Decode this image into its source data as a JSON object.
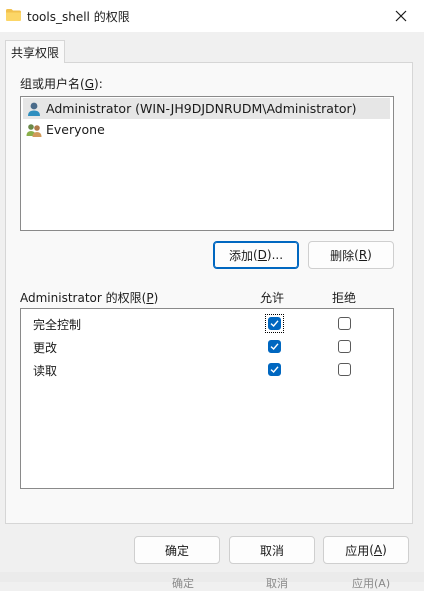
{
  "window": {
    "title": "tools_shell 的权限",
    "close_glyph": "✕"
  },
  "tab": {
    "label": "共享权限"
  },
  "group_section": {
    "label": "组或用户名",
    "hotkey": "G",
    "label_suffix": "):",
    "label_paren_open": "("
  },
  "users": [
    {
      "name": "Administrator (WIN-JH9DJDNRUDM\\Administrator)",
      "icon": "user-icon",
      "selected": true
    },
    {
      "name": "Everyone",
      "icon": "group-users-icon",
      "selected": false
    }
  ],
  "user_buttons": {
    "add": {
      "label": "添加",
      "hotkey": "D",
      "suffix": ")..."
    },
    "remove": {
      "label": "删除",
      "hotkey": "R",
      "suffix": ")"
    }
  },
  "permissions": {
    "label": "Administrator 的权限",
    "hotkey": "P",
    "allow_header": "允许",
    "deny_header": "拒绝",
    "rows": [
      {
        "name": "完全控制",
        "allow": true,
        "deny": false
      },
      {
        "name": "更改",
        "allow": true,
        "deny": false
      },
      {
        "name": "读取",
        "allow": true,
        "deny": false
      }
    ]
  },
  "dialog_buttons": {
    "ok": "确定",
    "cancel": "取消",
    "apply": {
      "label": "应用",
      "hotkey": "A",
      "suffix": ")"
    }
  },
  "background_window": {
    "ok": "确定",
    "cancel": "取消",
    "apply": "应用(A)"
  },
  "colors": {
    "accent": "#0067c0",
    "panel": "#f9f9f9",
    "dialog": "#f0f0f0"
  }
}
